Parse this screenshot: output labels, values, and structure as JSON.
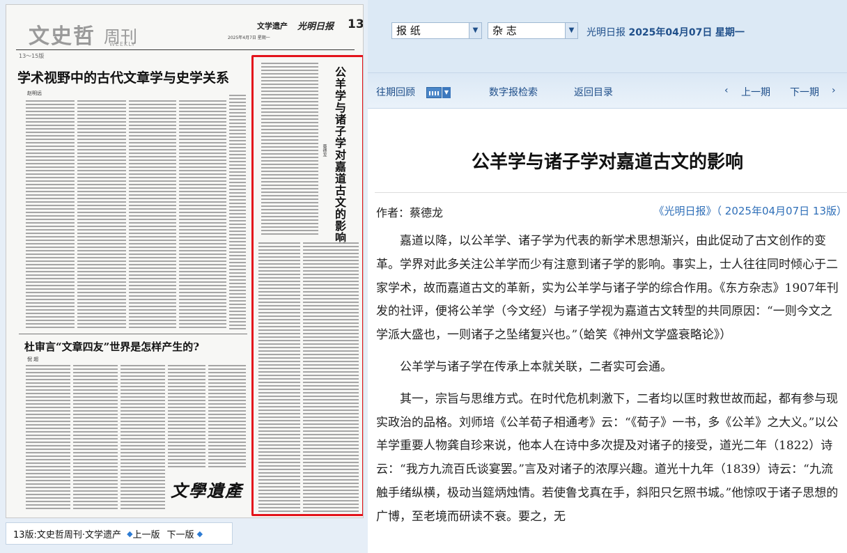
{
  "newspaper": {
    "masthead_title": "文史哲",
    "masthead_week": "周刊",
    "masthead_weekly": "WEEKLY",
    "pages_range": "13～15版",
    "section": "文学遗产",
    "logo": "光明日报",
    "page_number": "13",
    "date_line": "2025年4月7日 星期一",
    "headline_1": "学术视野中的古代文章学与史学关系",
    "byline_1": "赵明远",
    "headline_2": "杜审言“文章四友”世界是怎样产生的?",
    "byline_2": "倪 超",
    "highlight_headline": "公羊学与诸子学对嘉道古文的影响",
    "highlight_byline": "蔡德龙",
    "seal_text": "文學遺產"
  },
  "page_nav": {
    "page_name": "13版:文史哲周刊·文学遗产",
    "prev": "上一版",
    "next": "下一版"
  },
  "top_bar": {
    "paper_select": "报 纸",
    "magazine_select": "杂 志",
    "paper_name": "光明日报",
    "date": "2025年04月07日",
    "weekday": "星期一"
  },
  "nav": {
    "past_review": "往期回顾",
    "digital_search": "数字报检索",
    "back_to_toc": "返回目录",
    "prev_issue": "上一期",
    "next_issue": "下一期"
  },
  "article": {
    "title": "公羊学与诸子学对嘉道古文的影响",
    "author": "作者：蔡德龙",
    "source": "《光明日报》（ 2025年04月07日 13版）",
    "paragraphs": [
      "嘉道以降，以公羊学、诸子学为代表的新学术思想渐兴，由此促动了古文创作的变革。学界对此多关注公羊学而少有注意到诸子学的影响。事实上，士人往往同时倾心于二家学术，故而嘉道古文的革新，实为公羊学与诸子学的综合作用。《东方杂志》1907年刊发的社评，便将公羊学（今文经）与诸子学视为嘉道古文转型的共同原因：“一则今文之学派大盛也，一则诸子之坠绪复兴也。”（蛤笑《神州文学盛衰略论》）",
      "公羊学与诸子学在传承上本就关联，二者实可会通。",
      "其一，宗旨与思维方式。在时代危机刺激下，二者均以匡时救世故而起，都有参与现实政治的品格。刘师培《公羊荀子相通考》云：“《荀子》一书，多《公羊》之大义。”以公羊学重要人物龚自珍来说，他本人在诗中多次提及对诸子的接受，道光二年（1822）诗云：“我方九流百氏谈宴罢。”言及对诸子的浓厚兴趣。道光十九年（1839）诗云：“九流触手绪纵横，极动当筵炳烛情。若使鲁戈真在手，斜阳只乞照书城。”他惊叹于诸子思想的广博，至老境而研读不衰。要之，无"
    ]
  },
  "colors": {
    "highlight_border": "#e3131b",
    "link_blue": "#2f6fb8",
    "nav_text": "#1f4f8a"
  }
}
